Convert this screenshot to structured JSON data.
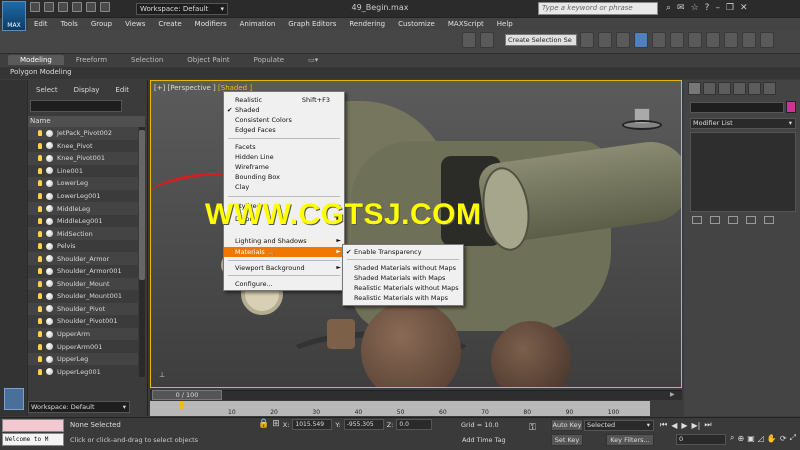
{
  "app": {
    "logo": "MAX",
    "doc_title": "49_Begin.max",
    "workspace": "Workspace: Default",
    "search_placeholder": "Type a keyword or phrase"
  },
  "menubar": [
    "Edit",
    "Tools",
    "Group",
    "Views",
    "Create",
    "Modifiers",
    "Animation",
    "Graph Editors",
    "Rendering",
    "Customize",
    "MAXScript",
    "Help"
  ],
  "toolbar": {
    "selection_set": "Create Selection Se"
  },
  "ribbon": {
    "tabs": [
      "Modeling",
      "Freeform",
      "Selection",
      "Object Paint",
      "Populate"
    ],
    "active_tab": "Modeling",
    "sub_label": "Polygon Modeling"
  },
  "explorer": {
    "menu": [
      "Select",
      "Display",
      "Edit"
    ],
    "column": "Name",
    "items": [
      {
        "name": "JetPack_Pivot002",
        "kind": "ball"
      },
      {
        "name": "Knee_Pivot",
        "kind": "ball"
      },
      {
        "name": "Knee_Pivot001",
        "kind": "ball"
      },
      {
        "name": "Line001",
        "kind": "ball"
      },
      {
        "name": "LowerLeg",
        "kind": "ball"
      },
      {
        "name": "LowerLeg001",
        "kind": "ball"
      },
      {
        "name": "MiddleLeg",
        "kind": "ball"
      },
      {
        "name": "MiddleLeg001",
        "kind": "ball"
      },
      {
        "name": "MidSection",
        "kind": "ball"
      },
      {
        "name": "Pelvis",
        "kind": "ball"
      },
      {
        "name": "Shoulder_Armor",
        "kind": "ball"
      },
      {
        "name": "Shoulder_Armor001",
        "kind": "ball"
      },
      {
        "name": "Shoulder_Mount",
        "kind": "ball"
      },
      {
        "name": "Shoulder_Mount001",
        "kind": "ball"
      },
      {
        "name": "Shoulder_Pivot",
        "kind": "ball"
      },
      {
        "name": "Shoulder_Pivot001",
        "kind": "ball"
      },
      {
        "name": "UpperArm",
        "kind": "ball"
      },
      {
        "name": "UpperArm001",
        "kind": "ball"
      },
      {
        "name": "UpperLeg",
        "kind": "ball"
      },
      {
        "name": "UpperLeg001",
        "kind": "ball"
      }
    ],
    "workspace": "Workspace: Default"
  },
  "viewport": {
    "label_prefix": "[+] [Perspective ]",
    "label_shading": "[Shaded ]",
    "watermark": "WWW.CGTSJ.COM"
  },
  "context_menu": {
    "items": [
      {
        "label": "Realistic",
        "shortcut": "Shift+F3"
      },
      {
        "label": "Shaded",
        "checked": "✔"
      },
      {
        "label": "Consistent Colors"
      },
      {
        "label": "Edged Faces"
      },
      {
        "label": "Facets"
      },
      {
        "label": "Hidden Line"
      },
      {
        "label": "Wireframe"
      },
      {
        "label": "Bounding Box"
      },
      {
        "label": "Clay"
      },
      {
        "label": "Stylized"
      },
      {
        "label": "Display"
      },
      {
        "label": "Lighting and Shadows"
      },
      {
        "label": "Materials"
      },
      {
        "label": "Viewport Background"
      },
      {
        "label": "Configure..."
      }
    ],
    "highlighted": "Materials",
    "arrow": "►"
  },
  "submenu": {
    "items": [
      {
        "label": "Enable Transparency",
        "checked": "✔"
      },
      {
        "label": "Shaded Materials without Maps"
      },
      {
        "label": "Shaded Materials with Maps"
      },
      {
        "label": "Realistic Materials without Maps"
      },
      {
        "label": "Realistic Materials with Maps"
      }
    ]
  },
  "command_panel": {
    "modifier_list": "Modifier List"
  },
  "time": {
    "slider": "0 / 100",
    "ticks": [
      "10",
      "20",
      "30",
      "40",
      "50",
      "60",
      "70",
      "80",
      "90",
      "100"
    ]
  },
  "status": {
    "selection": "None Selected",
    "prompt": "Click or click-and-drag to select objects",
    "maxscript": "Welcome to M",
    "x_label": "X:",
    "x_value": "1015.549",
    "y_label": "Y:",
    "y_value": "-955.305",
    "z_label": "Z:",
    "z_value": "0.0",
    "grid": "Grid = 10.0",
    "add_time_tag": "Add Time Tag",
    "auto_key": "Auto Key",
    "set_key": "Set Key",
    "selected": "Selected",
    "key_filters": "Key Filters...",
    "frame": "0"
  },
  "colors": {
    "accent_highlight": "#f07800",
    "viewport_border": "#e6b800",
    "object_color": "#cc3399",
    "watermark": "#ffff00"
  }
}
